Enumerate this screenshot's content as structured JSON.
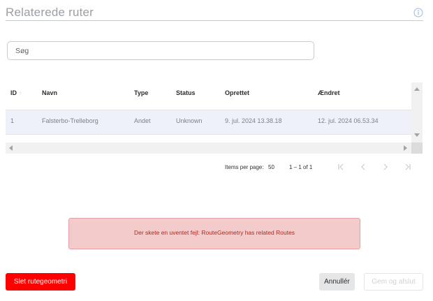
{
  "header": {
    "title": "Relaterede ruter",
    "info_icon": "info-icon"
  },
  "search": {
    "placeholder": "Søg",
    "value": ""
  },
  "table": {
    "columns": [
      "ID",
      "Navn",
      "Type",
      "Status",
      "Oprettet",
      "Ændret"
    ],
    "sorted_column": "ID",
    "rows": [
      [
        "1",
        "Falsterbo-Trelleborg",
        "Andet",
        "Unknown",
        "9. jul. 2024 13.38.18",
        "12. jul. 2024 06.53.34"
      ]
    ]
  },
  "paginator": {
    "items_per_page_label": "Items per page:",
    "items_per_page_value": "50",
    "range_label": "1 – 1 of 1"
  },
  "error": {
    "message": "Der skete en uventet fejl: RouteGeometry has related Routes"
  },
  "actions": {
    "delete_label": "Slet rutegeometri",
    "cancel_label": "Annullér",
    "save_label": "Gem og afslut"
  },
  "colors": {
    "delete_button": "#ff0000",
    "error_background": "#f3cbcb",
    "error_text": "#b3261e",
    "selected_row": "#eef0fa"
  }
}
